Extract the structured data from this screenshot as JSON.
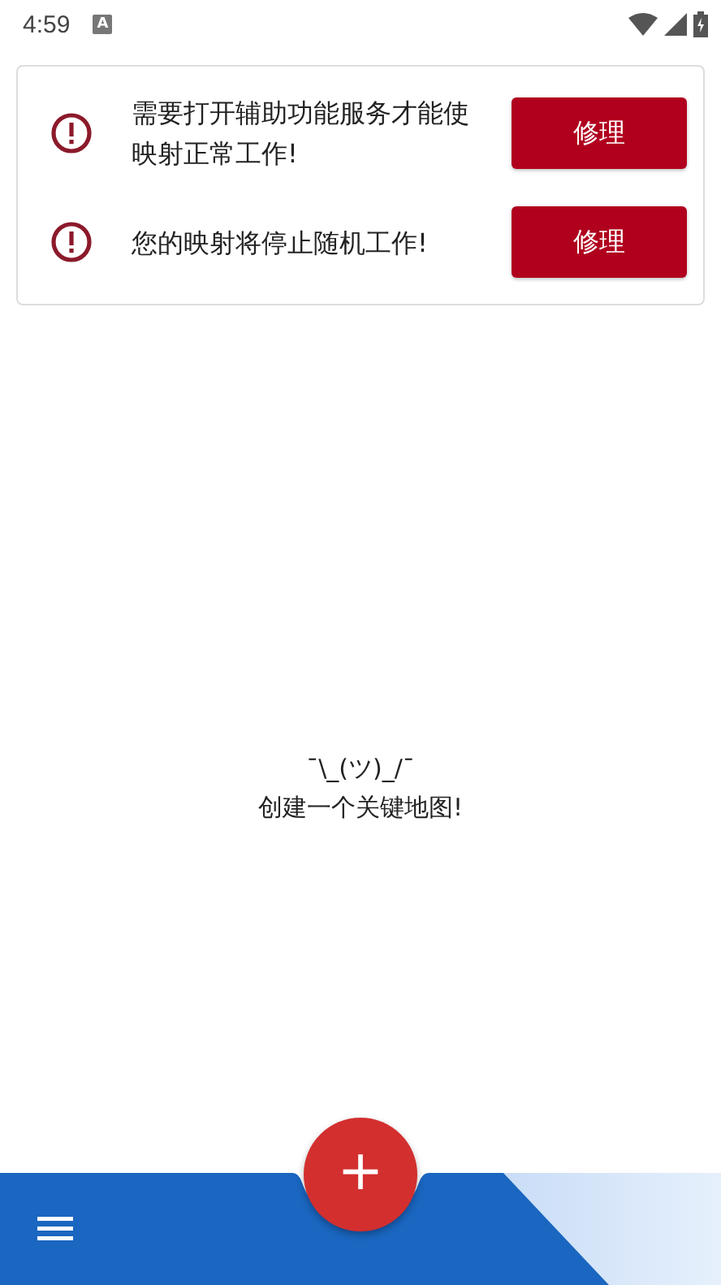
{
  "status_bar": {
    "time": "4:59",
    "notification_icon": "A"
  },
  "warnings": [
    {
      "message": "需要打开辅助功能服务才能使映射正常工作!",
      "button": "修理"
    },
    {
      "message": "您的映射将停止随机工作!",
      "button": "修理"
    }
  ],
  "empty_state": {
    "emoticon": "¯\\_(ツ)_/¯",
    "message": "创建一个关键地图!"
  },
  "fab": {
    "label": "+"
  }
}
